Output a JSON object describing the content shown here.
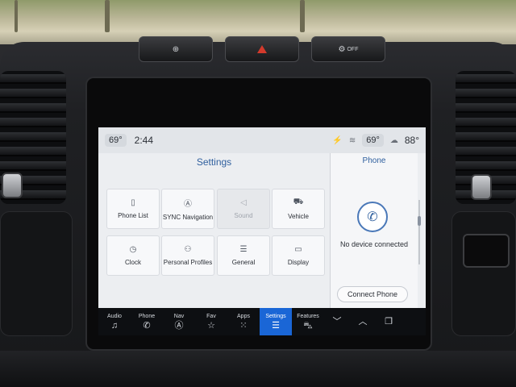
{
  "status": {
    "cabin_temp": "69°",
    "time": "2:44",
    "driver_temp": "69°",
    "outside_temp": "88°",
    "icons": [
      "mic-off-icon",
      "wifi-icon",
      "cloud-sun-icon"
    ]
  },
  "hardware_buttons": [
    {
      "name": "lane-keep-icon",
      "label": ""
    },
    {
      "name": "hazard-icon",
      "label": ""
    },
    {
      "name": "drive-mode-off-icon",
      "label": "OFF"
    }
  ],
  "settings": {
    "title": "Settings",
    "tiles": [
      {
        "label": "Phone List",
        "icon": "phone-list-icon",
        "enabled": true
      },
      {
        "label": "SYNC Navigation",
        "icon": "navigation-icon",
        "enabled": true
      },
      {
        "label": "Sound",
        "icon": "speaker-icon",
        "enabled": false
      },
      {
        "label": "Vehicle",
        "icon": "vehicle-icon",
        "enabled": true
      },
      {
        "label": "Clock",
        "icon": "clock-icon",
        "enabled": true
      },
      {
        "label": "Personal Profiles",
        "icon": "profiles-icon",
        "enabled": true
      },
      {
        "label": "General",
        "icon": "sliders-icon",
        "enabled": true
      },
      {
        "label": "Display",
        "icon": "display-icon",
        "enabled": true
      }
    ],
    "page_index": 1,
    "page_count": 2
  },
  "phone": {
    "title": "Phone",
    "message": "No device connected",
    "connect_label": "Connect Phone"
  },
  "nav": [
    {
      "label": "Audio",
      "icon": "music-note-icon"
    },
    {
      "label": "Phone",
      "icon": "phone-icon"
    },
    {
      "label": "Nav",
      "icon": "navigation-icon"
    },
    {
      "label": "Fav",
      "icon": "star-icon"
    },
    {
      "label": "Apps",
      "icon": "apps-grid-icon"
    },
    {
      "label": "Settings",
      "icon": "settings-sliders-icon",
      "active": true
    },
    {
      "label": "Features",
      "icon": "car-icon"
    },
    {
      "label": "",
      "icon": "chevron-down-icon"
    },
    {
      "label": "",
      "icon": "chevron-up-icon"
    },
    {
      "label": "",
      "icon": "windows-icon"
    }
  ],
  "colors": {
    "accent": "#1a66d6",
    "title_blue": "#2f5f9e",
    "hazard": "#d33a2c"
  }
}
